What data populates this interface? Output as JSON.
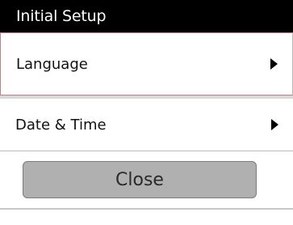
{
  "screen": {
    "title": "Initial Setup"
  },
  "menu": {
    "items": [
      {
        "label": "Language",
        "icon": "arrow-right-icon"
      },
      {
        "label": "Date & Time",
        "icon": "arrow-right-icon"
      }
    ]
  },
  "actions": {
    "close_label": "Close"
  }
}
